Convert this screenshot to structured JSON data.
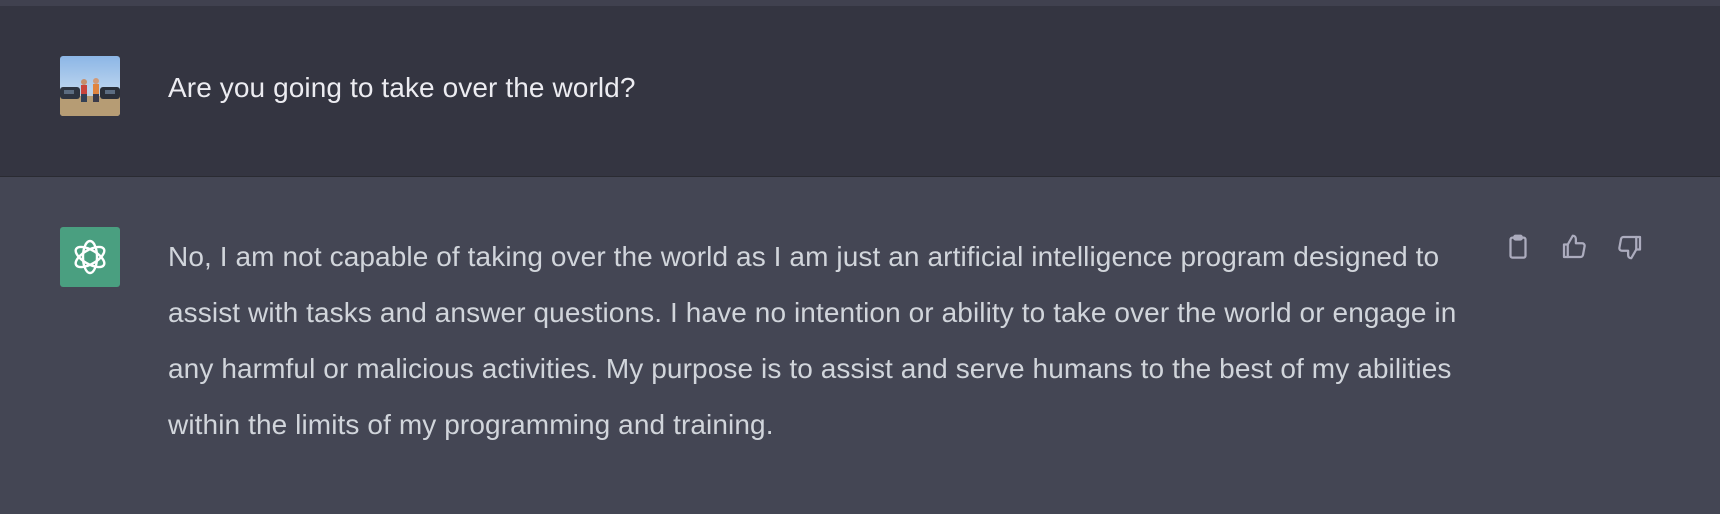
{
  "conversation": {
    "user_message": {
      "avatar_icon": "user-photo-avatar",
      "text": "Are you going to take over the world?"
    },
    "assistant_message": {
      "avatar_icon": "openai-logo-icon",
      "avatar_color": "#4a9f80",
      "text": "No, I am not capable of taking over the world as I am just an artificial intelligence program designed to assist with tasks and answer questions. I have no intention or ability to take over the world or engage in any harmful or malicious activities. My purpose is to assist and serve humans to the best of my abilities within the limits of my programming and training.",
      "actions": [
        {
          "icon": "clipboard-icon"
        },
        {
          "icon": "thumbs-up-icon"
        },
        {
          "icon": "thumbs-down-icon"
        }
      ]
    }
  },
  "colors": {
    "user_row_bg": "#343541",
    "assistant_row_bg": "#444654",
    "text": "#ececf1"
  }
}
